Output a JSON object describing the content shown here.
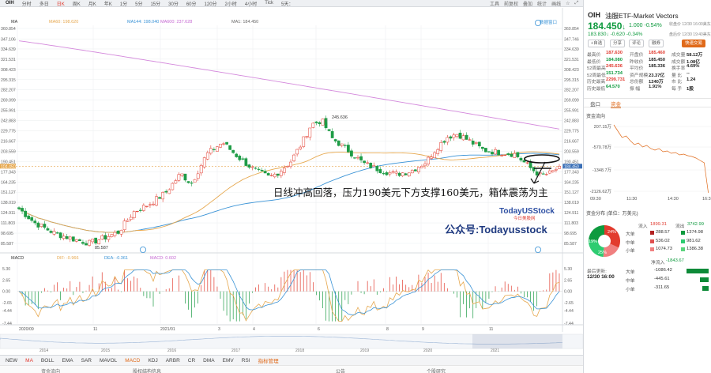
{
  "toolbar": {
    "ticker": "OIH",
    "items": [
      "分时",
      "多日",
      "日K",
      "周K",
      "月K",
      "年K",
      "1分",
      "5分",
      "15分",
      "30分",
      "60分",
      "120分",
      "2小时",
      "4小时",
      "Tick",
      "5天："
    ],
    "active_index": 2,
    "right": [
      "工具",
      "前复权",
      "叠加",
      "统计",
      "画线",
      "☆",
      "⤢"
    ]
  },
  "ma_legend": {
    "ma_label": "MA",
    "items": [
      {
        "text": "MA60: 198.620",
        "color": "#e6a84f"
      },
      {
        "text": "MA144: 198.040",
        "color": "#3a93d6"
      },
      {
        "text": "MA600: 237.628",
        "color": "#c568d2"
      },
      {
        "text": "MA1: 184.450",
        "color": "#666666"
      }
    ],
    "settings": "数据窗口"
  },
  "price_axis": {
    "left": [
      "360.854",
      "347.106",
      "334.639",
      "321.531",
      "308.423",
      "295.315",
      "282.207",
      "269.099",
      "255.991",
      "242.883",
      "229.775",
      "216.667",
      "203.559",
      "190.451",
      "184.450",
      "177.343",
      "164.235",
      "151.127",
      "138.019",
      "124.911",
      "111.803",
      "98.695",
      "85.587"
    ],
    "right": [
      "360.854",
      "347.746",
      "334.639",
      "321.531",
      "308.423",
      "295.315",
      "282.207",
      "269.099",
      "255.991",
      "242.883",
      "229.775",
      "216.667",
      "203.559",
      "190.451",
      "184.450",
      "177.343",
      "164.235",
      "151.127",
      "138.019",
      "124.911",
      "111.803",
      "98.695",
      "85.587"
    ]
  },
  "annotations": {
    "peak": "245.636",
    "low": "85.587",
    "comment": "日线冲高回落，压力190美元下方支撑160美元，箱体震荡为主",
    "watermark_brand": "TodayUSStock",
    "watermark_sub": "今日美股网",
    "wechat": "公众号:Todayusstock"
  },
  "macd_legend": {
    "label": "MACD",
    "items": [
      {
        "text": "DIF: -0.966",
        "color": "#e6a84f"
      },
      {
        "text": "DEA: -0.361",
        "color": "#3a93d6"
      },
      {
        "text": "MACD: 0.602",
        "color": "#c568d2"
      }
    ]
  },
  "macd_axis": [
    "5.30",
    "2.65",
    "0.00",
    "-2.65",
    "-4.44",
    "-7.44"
  ],
  "time_axis": [
    "2020/09",
    "11",
    "2021/01",
    "3",
    "4",
    "6",
    "8",
    "9",
    "11"
  ],
  "year_axis": [
    "2014",
    "2015",
    "2016",
    "2017",
    "2018",
    "2019",
    "2020",
    "2021"
  ],
  "indicators": [
    "NEW",
    "MA",
    "BOLL",
    "EMA",
    "SAR",
    "MAVOL",
    "MACD",
    "KDJ",
    "ARBR",
    "CR",
    "DMA",
    "EMV",
    "RSI",
    "指标管理"
  ],
  "bottom_row2": [
    "资金流向",
    "股权结构信息",
    "公告",
    "个股研究"
  ],
  "quote": {
    "ticker": "OIH",
    "name": "油服ETF-Market Vectors",
    "price": "184.450",
    "change": "1.000",
    "change_pct": "-0.54%",
    "status": "收盘价 12/30 16:00美东",
    "after_price": "183.830",
    "after_change": "-0.620",
    "after_pct": "-0.34%",
    "after_status": "盘后价 12/30 19:40美东",
    "buttons": [
      "+自选",
      "分享",
      "评论",
      "融券",
      "快速交易"
    ],
    "stats": [
      {
        "label": "最高价",
        "value": "187.630",
        "color": "red"
      },
      {
        "label": "开盘价",
        "value": "185.460",
        "color": "red"
      },
      {
        "label": "成交量",
        "value": "58.12万",
        "color": "dark"
      },
      {
        "label": "最低价",
        "value": "184.080",
        "color": "green"
      },
      {
        "label": "昨收价",
        "value": "185.450",
        "color": "dark"
      },
      {
        "label": "成交额",
        "value": "1.08亿",
        "color": "dark"
      },
      {
        "label": "52周最高",
        "value": "245.636",
        "color": "red"
      },
      {
        "label": "平均价",
        "value": "185.336",
        "color": "dark"
      },
      {
        "label": "换手率",
        "value": "4.69%",
        "color": "dark"
      },
      {
        "label": "52周最低",
        "value": "151.734",
        "color": "green"
      },
      {
        "label": "资产规模",
        "value": "23.37亿",
        "color": "dark"
      },
      {
        "label": "量 比",
        "value": "--",
        "color": "dark"
      },
      {
        "label": "历史最高",
        "value": "2299.731",
        "color": "red"
      },
      {
        "label": "总份额",
        "value": "1240万",
        "color": "dark"
      },
      {
        "label": "市 比",
        "value": "1.24",
        "color": "dark"
      },
      {
        "label": "历史最低",
        "value": "64.570",
        "color": "green"
      },
      {
        "label": "振 幅",
        "value": "1.91%",
        "color": "dark"
      },
      {
        "label": "每 手",
        "value": "1股",
        "color": "dark"
      }
    ],
    "tabs": [
      "盘口",
      "资金"
    ],
    "flow_title": "资金流向",
    "flow_axis": [
      "207.15万",
      "-570.78万",
      "-1348.7万",
      "-2126.62万"
    ],
    "flow_times": [
      "09:30",
      "11:30",
      "14:30",
      "16:30"
    ],
    "dist_title": "资金分布 (单位：万美元)",
    "inflow_label": "流入",
    "inflow_total": "1899.31",
    "outflow_label": "流出",
    "outflow_total": "3742.99",
    "donut": [
      {
        "label": "24%",
        "color": "#0e9a3e"
      },
      {
        "label": "19%",
        "color": "#f08080"
      },
      {
        "label": "25%",
        "color": "#2ecc71"
      }
    ],
    "rows": [
      {
        "label": "大单",
        "in": "288.57",
        "out": "1374.98"
      },
      {
        "label": "中单",
        "in": "536.02",
        "out": "981.62"
      },
      {
        "label": "小单",
        "in": "1074.73",
        "out": "1386.38"
      }
    ],
    "net_label": "净流入",
    "net_value": "-1843.67",
    "updated_label": "最后更新:",
    "updated_time": "12/30 16:00",
    "net_rows": [
      {
        "label": "大单",
        "value": "-1086.42",
        "frac": 1.0
      },
      {
        "label": "中单",
        "value": "-445.61",
        "frac": 0.41
      },
      {
        "label": "小单",
        "value": "-311.65",
        "frac": 0.29
      }
    ]
  }
}
